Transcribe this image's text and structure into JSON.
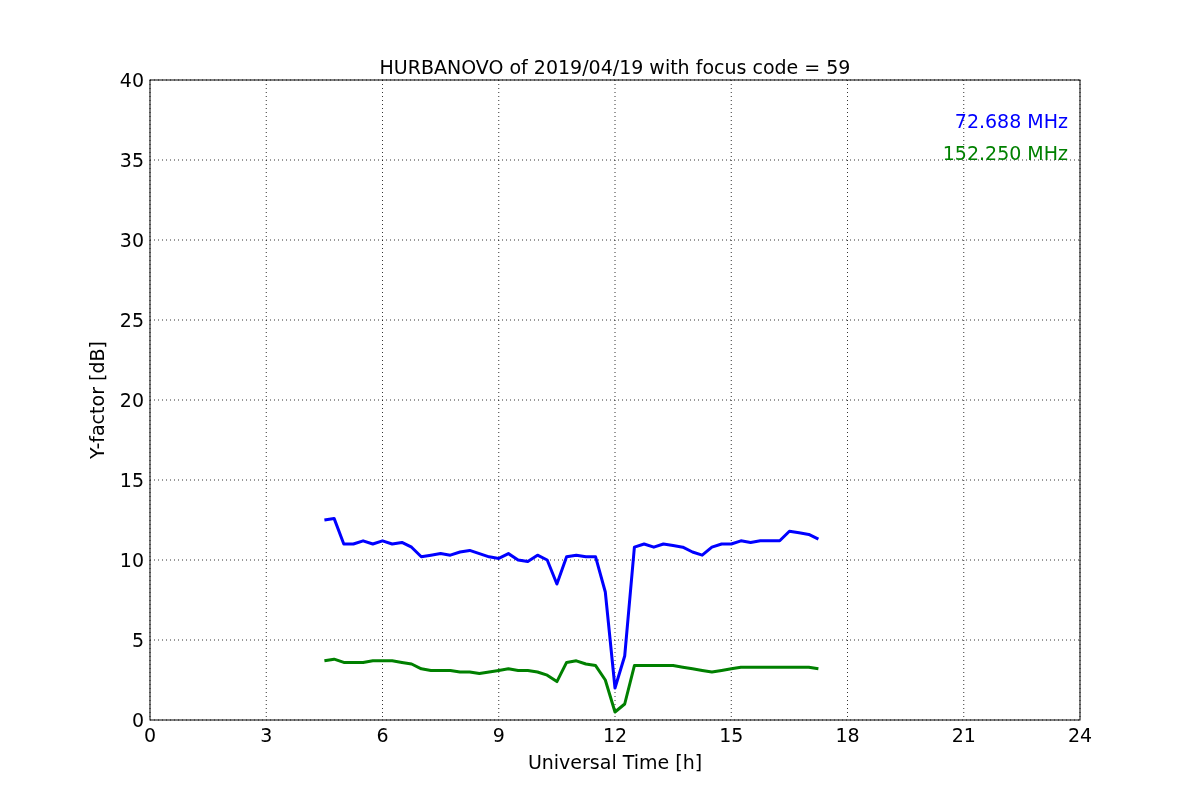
{
  "figure": {
    "chart_data": {
      "type": "line",
      "title": "HURBANOVO of 2019/04/19 with focus code = 59",
      "xlabel": "Universal Time [h]",
      "ylabel": "Y-factor [dB]",
      "x": [
        4.5,
        4.75,
        5,
        5.25,
        5.5,
        5.75,
        6,
        6.25,
        6.5,
        6.75,
        7,
        7.25,
        7.5,
        7.75,
        8,
        8.25,
        8.5,
        8.75,
        9,
        9.25,
        9.5,
        9.75,
        10,
        10.25,
        10.5,
        10.75,
        11,
        11.25,
        11.5,
        11.75,
        12,
        12.25,
        12.5,
        12.75,
        13,
        13.25,
        13.5,
        13.75,
        14,
        14.25,
        14.5,
        14.75,
        15,
        15.25,
        15.5,
        15.75,
        16,
        16.25,
        16.5,
        16.75,
        17,
        17.25
      ],
      "series": [
        {
          "name": "72.688 MHz",
          "color": "#0000ff",
          "values": [
            12.5,
            12.6,
            11,
            11,
            11.2,
            11,
            11.2,
            11,
            11.1,
            10.8,
            10.2,
            10.3,
            10.4,
            10.3,
            10.5,
            10.6,
            10.4,
            10.2,
            10.1,
            10.4,
            10,
            9.9,
            10.3,
            10,
            8.5,
            10.2,
            10.3,
            10.2,
            10.2,
            8,
            2,
            4,
            10.8,
            11,
            10.8,
            11,
            10.9,
            10.8,
            10.5,
            10.3,
            10.8,
            11,
            11,
            11.2,
            11.1,
            11.2,
            11.2,
            11.2,
            11.8,
            11.7,
            11.6,
            11.3
          ]
        },
        {
          "name": "152.250 MHz",
          "color": "#008000",
          "values": [
            3.7,
            3.8,
            3.6,
            3.6,
            3.6,
            3.7,
            3.7,
            3.7,
            3.6,
            3.5,
            3.2,
            3.1,
            3.1,
            3.1,
            3,
            3,
            2.9,
            3,
            3.1,
            3.2,
            3.1,
            3.1,
            3,
            2.8,
            2.4,
            3.6,
            3.7,
            3.5,
            3.4,
            2.5,
            0.5,
            1,
            3.4,
            3.4,
            3.4,
            3.4,
            3.4,
            3.3,
            3.2,
            3.1,
            3,
            3.1,
            3.2,
            3.3,
            3.3,
            3.3,
            3.3,
            3.3,
            3.3,
            3.3,
            3.3,
            3.2
          ]
        }
      ],
      "xlim": [
        0,
        24
      ],
      "ylim": [
        0,
        40
      ],
      "xticks": [
        0,
        3,
        6,
        9,
        12,
        15,
        18,
        21,
        24
      ],
      "yticks": [
        0,
        5,
        10,
        15,
        20,
        25,
        30,
        35,
        40
      ],
      "grid": true
    }
  }
}
